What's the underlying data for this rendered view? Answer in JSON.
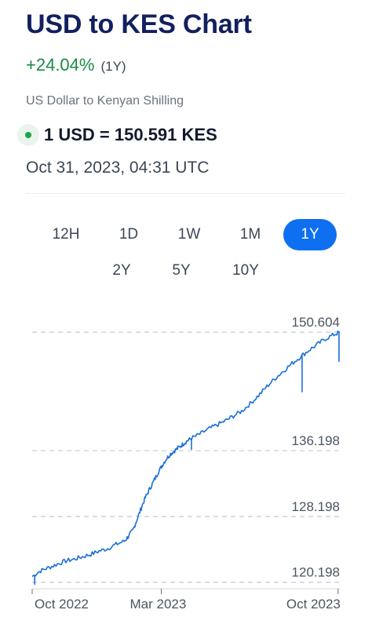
{
  "header": {
    "title": "USD to KES Chart",
    "change": "+24.04%",
    "period": "(1Y)",
    "subtitle": "US Dollar to Kenyan Shilling",
    "rate": "1 USD = 150.591 KES",
    "timestamp": "Oct 31, 2023, 04:31 UTC"
  },
  "ranges": {
    "row1": [
      "12H",
      "1D",
      "1W",
      "1M",
      "1Y"
    ],
    "row2": [
      "2Y",
      "5Y",
      "10Y"
    ],
    "selected": "1Y"
  },
  "colors": {
    "accent": "#0e6ff0",
    "positive": "#1a8a47",
    "line": "#1b6fd8",
    "title": "#13205f"
  },
  "chart_data": {
    "type": "line",
    "title": "",
    "xlabel": "",
    "ylabel": "",
    "y_tick_labels": [
      "150.604",
      "136.198",
      "128.198",
      "120.198"
    ],
    "y_ticks": [
      150.604,
      136.198,
      128.198,
      120.198
    ],
    "x_tick_labels": [
      "Oct 2022",
      "Mar 2023",
      "Oct 2023"
    ],
    "x_tick_positions": [
      0,
      154,
      365
    ],
    "ylim": [
      119.6,
      150.9
    ],
    "xlim": [
      0,
      367
    ],
    "grid": "dashed horizontal",
    "legend": "none",
    "series": [
      {
        "x": [
          0,
          10,
          20,
          30,
          40,
          50,
          60,
          70,
          80,
          90,
          100,
          110,
          115,
          120,
          125,
          130,
          135,
          140,
          145,
          150,
          155,
          160,
          165,
          170,
          175,
          180,
          185,
          190,
          200,
          210,
          220,
          230,
          240,
          250,
          260,
          270,
          280,
          290,
          300,
          310,
          320,
          330,
          340,
          350,
          360,
          367
        ],
        "y": [
          120.9,
          121.6,
          122.0,
          122.4,
          122.8,
          123.0,
          123.3,
          123.6,
          124.0,
          124.3,
          124.8,
          125.2,
          125.8,
          126.5,
          127.8,
          129.2,
          130.5,
          131.5,
          132.5,
          133.5,
          134.4,
          135.2,
          135.8,
          136.2,
          136.6,
          137.0,
          137.4,
          137.7,
          138.2,
          138.8,
          139.3,
          139.8,
          140.4,
          141.0,
          141.9,
          142.9,
          144.0,
          145.0,
          145.9,
          146.8,
          147.6,
          148.4,
          149.1,
          149.8,
          150.3,
          150.6
        ],
        "dips": [
          {
            "x": 3,
            "y": 119.9
          },
          {
            "x": 190,
            "y": 136.3
          },
          {
            "x": 322,
            "y": 143.3
          },
          {
            "x": 366,
            "y": 147.0
          }
        ]
      }
    ]
  }
}
